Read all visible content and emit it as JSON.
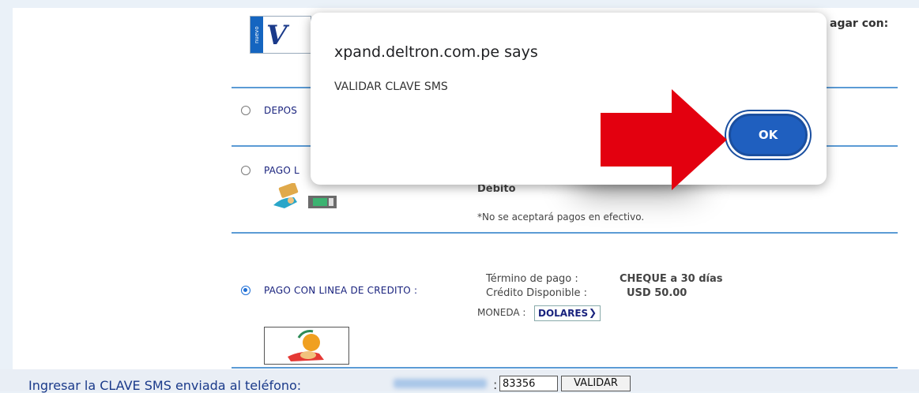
{
  "background_page": {
    "header_partial": "agar con:",
    "visa_logo": {
      "strip_text": "nuevo",
      "letter": "V"
    },
    "options": [
      {
        "label": "DEPOS",
        "selected": false
      },
      {
        "label": "PAGO L",
        "selected": false,
        "detail_line1": "Débito",
        "detail_line2": "*No se aceptará pagos en efectivo."
      },
      {
        "label": "PAGO CON LINEA DE CREDITO :",
        "selected": true
      }
    ],
    "credit_info": {
      "term_label": "Término de pago   :",
      "term_value": "CHEQUE a 30 días",
      "credit_label": "Crédito Disponible :",
      "credit_value": "USD 50.00",
      "currency_label": "MONEDA :",
      "currency_value": "DOLARES"
    },
    "sms": {
      "label": "Ingresar la CLAVE SMS enviada al teléfono:",
      "colon": ":",
      "input_value": "83356",
      "button_label": "VALIDAR"
    }
  },
  "dialog": {
    "title": "xpand.deltron.com.pe says",
    "message": "VALIDAR CLAVE SMS",
    "ok_label": "OK"
  },
  "colors": {
    "accent": "#1f5fbf",
    "divider": "#5b9bd5",
    "arrow": "#e3000f"
  }
}
